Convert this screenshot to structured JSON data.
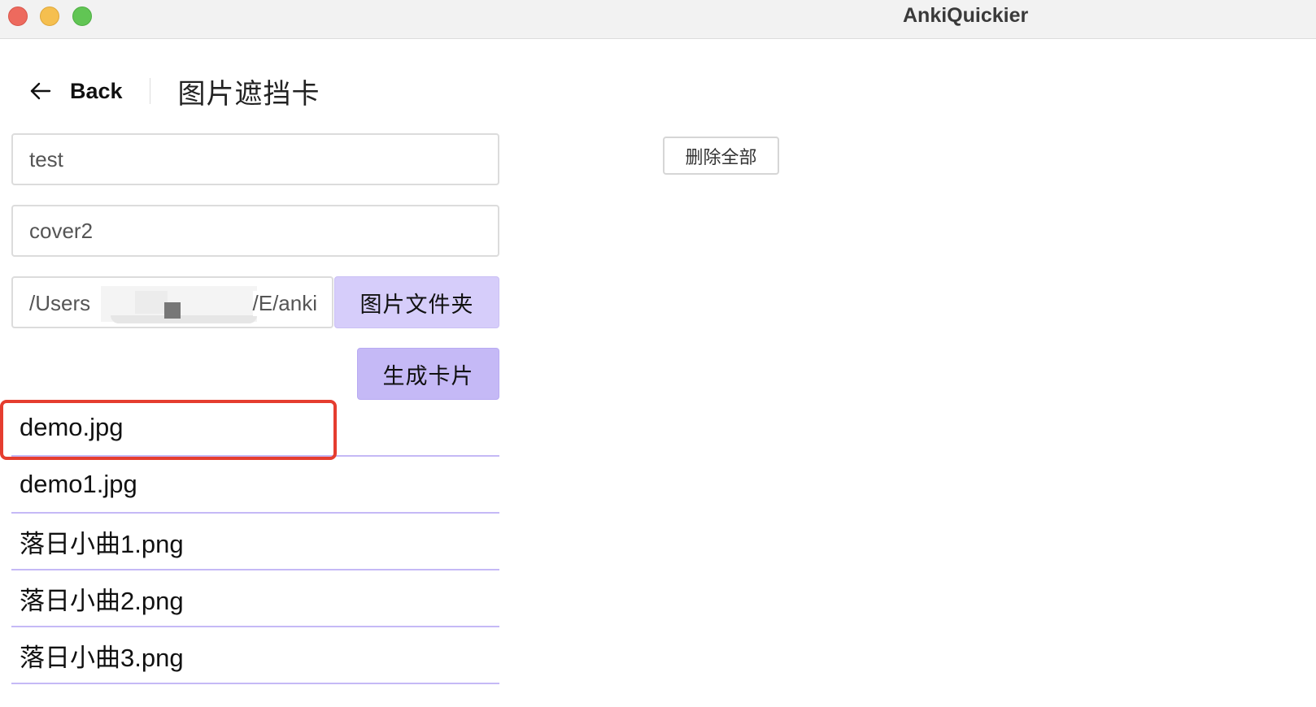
{
  "window": {
    "title": "AnkiQuickier",
    "controls": {
      "close": "#ed6a5e",
      "minimize": "#f5bf4f",
      "maximize": "#61c554"
    }
  },
  "header": {
    "back_icon": "arrow-left-icon",
    "back_label": "Back",
    "page_title": "图片遮挡卡"
  },
  "form": {
    "deck_field_value": "test",
    "model_field_value": "cover2",
    "path_field_start": "/Users",
    "path_field_end": "/E/anki",
    "folder_button_label": "图片文件夹",
    "generate_button_label": "生成卡片"
  },
  "actions": {
    "delete_all_label": "删除全部"
  },
  "files": [
    {
      "name": "demo.jpg",
      "highlighted": true
    },
    {
      "name": "demo1.jpg"
    },
    {
      "name": "落日小曲1.png"
    },
    {
      "name": "落日小曲2.png"
    },
    {
      "name": "落日小曲3.png"
    }
  ],
  "colors": {
    "accent_light": "#d6cdfa",
    "accent": "#c5b9f6",
    "highlight": "#e53d2f"
  }
}
